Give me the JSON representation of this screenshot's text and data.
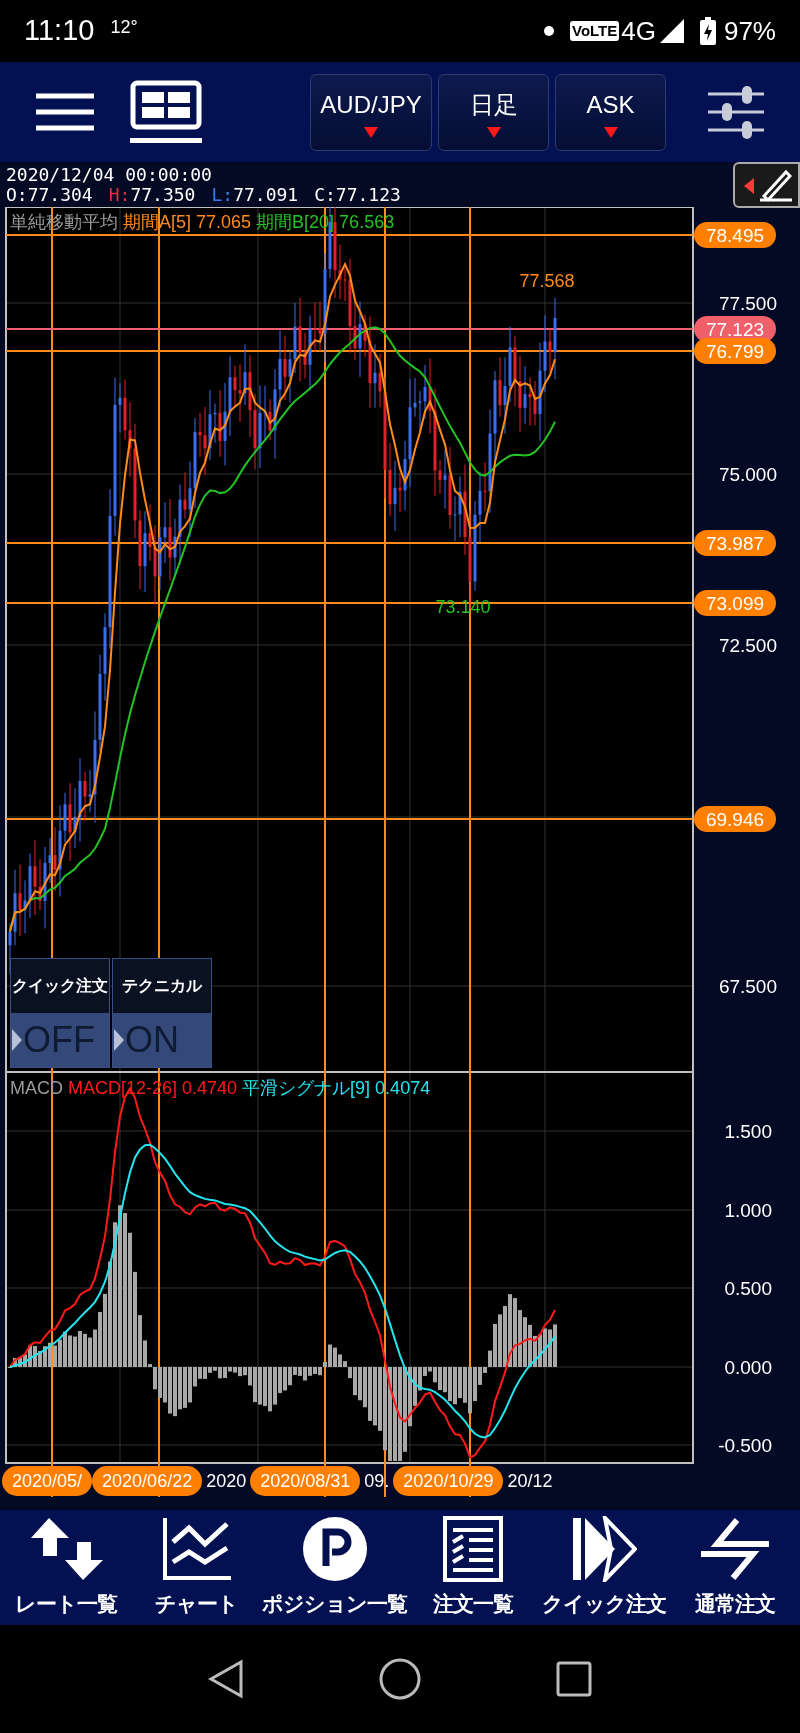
{
  "status_bar": {
    "time": "11:10",
    "temperature": "12°",
    "network_badge": "VoLTE",
    "network": "4G",
    "battery": "97%"
  },
  "toolbar": {
    "selectors": [
      {
        "label": "AUD/JPY"
      },
      {
        "label": "日足"
      },
      {
        "label": "ASK"
      }
    ]
  },
  "quote": {
    "datetime": "2020/12/04 00:00:00",
    "ohlc": [
      {
        "label": "O:",
        "value": "77.304",
        "color": "#ffffff"
      },
      {
        "label": "H:",
        "value": "77.350",
        "color": "#e0303a"
      },
      {
        "label": "L:",
        "value": "77.091",
        "color": "#3b7be8"
      },
      {
        "label": "C:",
        "value": "77.123",
        "color": "#ffffff"
      }
    ]
  },
  "price_chart": {
    "legend": [
      {
        "text": "単純移動平均",
        "color": "#9a9a9a"
      },
      {
        "text": "期間A[5] 77.065",
        "color": "#ff8c1a"
      },
      {
        "text": "期間B[20] 76.563",
        "color": "#22c322"
      }
    ],
    "axis_labels": [
      "77.500",
      "75.000",
      "72.500",
      "67.500"
    ],
    "price_tags": [
      {
        "text": "78.495",
        "kind": "line"
      },
      {
        "text": "77.123",
        "kind": "current"
      },
      {
        "text": "76.799",
        "kind": "line"
      },
      {
        "text": "73.987",
        "kind": "line"
      },
      {
        "text": "73.099",
        "kind": "line"
      },
      {
        "text": "69.946",
        "kind": "line"
      }
    ],
    "annotations": [
      {
        "text": "77.568",
        "color": "#ff8c1a"
      },
      {
        "text": "73.140",
        "color": "#22c322"
      }
    ],
    "toggles": [
      {
        "label": "クイック注文",
        "value": "OFF"
      },
      {
        "label": "テクニカル",
        "value": "ON"
      }
    ]
  },
  "macd_chart": {
    "legend": [
      {
        "text": "MACD",
        "color": "#9a9a9a"
      },
      {
        "text": "MACD[12-26] 0.4740",
        "color": "#ff1a1a"
      },
      {
        "text": "平滑シグナル[9] 0.4074",
        "color": "#22e5f0"
      }
    ],
    "axis_labels": [
      "1.500",
      "1.000",
      "0.500",
      "0.000",
      "-0.500"
    ]
  },
  "date_labels": [
    {
      "text": "2020/05/",
      "kind": "tag"
    },
    {
      "text": "2020/06/22",
      "kind": "tag"
    },
    {
      "text": "2020",
      "kind": "plain"
    },
    {
      "text": "2020/08/31",
      "kind": "tag"
    },
    {
      "text": "09.",
      "kind": "plain"
    },
    {
      "text": "2020/10/29",
      "kind": "tag"
    },
    {
      "text": "20/12",
      "kind": "plain"
    }
  ],
  "bottom_nav": [
    {
      "label": "レート一覧"
    },
    {
      "label": "チャート"
    },
    {
      "label": "ポジション一覧"
    },
    {
      "label": "注文一覧"
    },
    {
      "label": "クイック注文"
    },
    {
      "label": "通常注文"
    }
  ]
}
